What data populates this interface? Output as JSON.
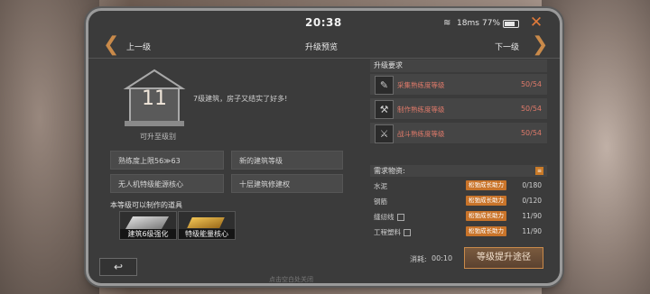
{
  "status": {
    "time": "20:38",
    "latency": "18ms",
    "battery": "77%",
    "battery_level": 0.77
  },
  "header": {
    "prev": "上一级",
    "title": "升级预览",
    "next": "下一级"
  },
  "level": {
    "number": "11",
    "upgrade_to": "可升至级别",
    "description": "7级建筑，房子又结实了好多!"
  },
  "features": [
    "熟练度上限56≫63",
    "新的建筑等级",
    "无人机特级能源核心",
    "十层建筑修建权"
  ],
  "craftable": {
    "label": "本等级可以制作的道具",
    "items": [
      "建筑6级强化",
      "特级能量核心"
    ]
  },
  "requirements": {
    "label": "升级要求",
    "rows": [
      {
        "name": "采集熟练度等级",
        "value": "50/54"
      },
      {
        "name": "制作熟练度等级",
        "value": "50/54"
      },
      {
        "name": "战斗熟练度等级",
        "value": "50/54"
      }
    ]
  },
  "materials": {
    "label": "需求物资:",
    "tag": "松弛成长助力",
    "rows": [
      {
        "name": "水泥",
        "value": "0/180"
      },
      {
        "name": "钢筋",
        "value": "0/120"
      },
      {
        "name": "缝纫线",
        "value": "11/90"
      },
      {
        "name": "工程塑料",
        "value": "11/90"
      }
    ]
  },
  "footer": {
    "consume_label": "消耗:",
    "consume_time": "00:10",
    "upgrade_button": "等级提升途径",
    "tap_close": "点击空白处关闭"
  },
  "colors": {
    "accent": "#c98a4a",
    "warning_text": "#e07a6a",
    "tag_bg": "#c9742a"
  }
}
